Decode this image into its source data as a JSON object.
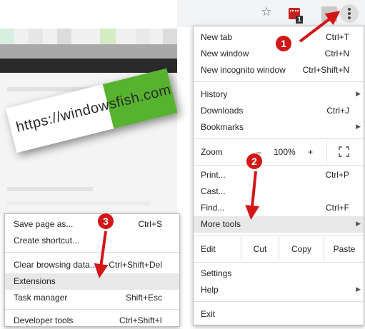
{
  "toolbar": {
    "star_icon": "star-icon",
    "extension_badge": "1",
    "menu_icon": "vertical-dots-icon"
  },
  "watermark": {
    "text": "https://windowsfish.com"
  },
  "main_menu": {
    "new_tab": {
      "label": "New tab",
      "shortcut": "Ctrl+T"
    },
    "new_window": {
      "label": "New window",
      "shortcut": "Ctrl+N"
    },
    "new_incognito": {
      "label": "New incognito window",
      "shortcut": "Ctrl+Shift+N"
    },
    "history": {
      "label": "History"
    },
    "downloads": {
      "label": "Downloads",
      "shortcut": "Ctrl+J"
    },
    "bookmarks": {
      "label": "Bookmarks"
    },
    "zoom": {
      "label": "Zoom",
      "minus": "–",
      "value": "100%",
      "plus": "+"
    },
    "print": {
      "label": "Print...",
      "shortcut": "Ctrl+P"
    },
    "cast": {
      "label": "Cast..."
    },
    "find": {
      "label": "Find...",
      "shortcut": "Ctrl+F"
    },
    "more_tools": {
      "label": "More tools"
    },
    "edit": {
      "label": "Edit",
      "cut": "Cut",
      "copy": "Copy",
      "paste": "Paste"
    },
    "settings": {
      "label": "Settings"
    },
    "help": {
      "label": "Help"
    },
    "exit": {
      "label": "Exit"
    }
  },
  "sub_menu": {
    "save_page": {
      "label": "Save page as...",
      "shortcut": "Ctrl+S"
    },
    "create_shortcut": {
      "label": "Create shortcut..."
    },
    "clear_data": {
      "label": "Clear browsing data...",
      "shortcut": "Ctrl+Shift+Del"
    },
    "extensions": {
      "label": "Extensions"
    },
    "task_manager": {
      "label": "Task manager",
      "shortcut": "Shift+Esc"
    },
    "developer_tools": {
      "label": "Developer tools",
      "shortcut": "Ctrl+Shift+I"
    }
  },
  "annotations": {
    "step1": "1",
    "step2": "2",
    "step3": "3",
    "color": "#d31616"
  }
}
